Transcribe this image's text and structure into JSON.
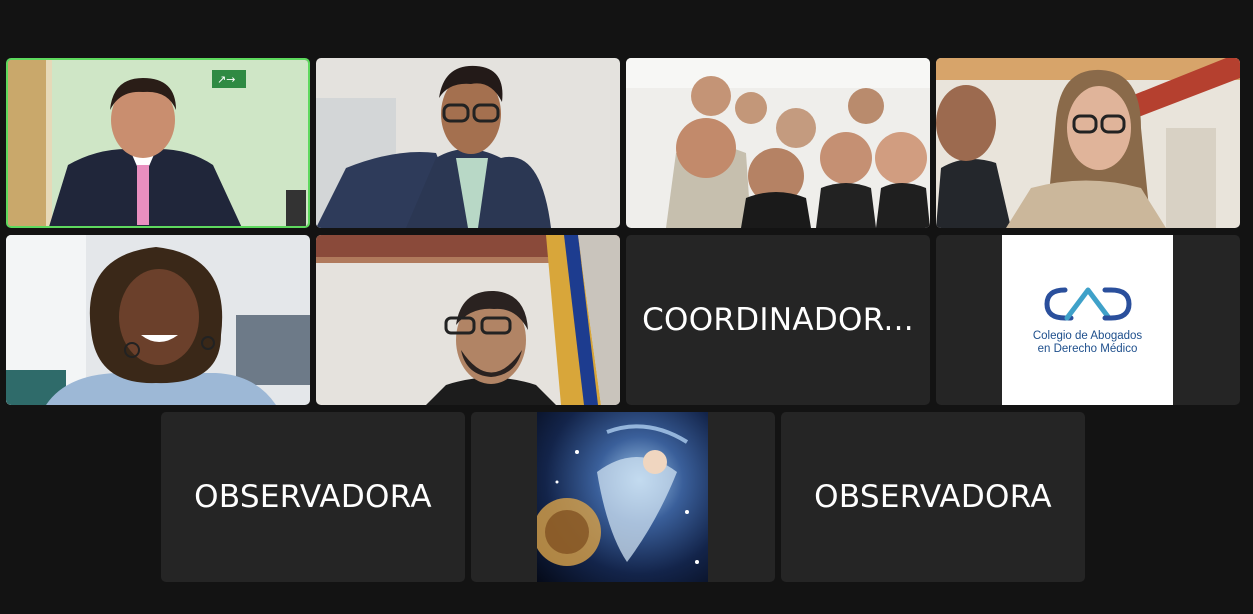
{
  "meeting": {
    "participants": [
      {
        "id": "p1",
        "kind": "video",
        "active": true
      },
      {
        "id": "p2",
        "kind": "video"
      },
      {
        "id": "p3",
        "kind": "video"
      },
      {
        "id": "p4",
        "kind": "video"
      },
      {
        "id": "p5",
        "kind": "video"
      },
      {
        "id": "p6",
        "kind": "video"
      },
      {
        "id": "p7",
        "kind": "name",
        "name": "COORDINADOR..."
      },
      {
        "id": "p8",
        "kind": "logo",
        "logo_line1": "Colegio de Abogados",
        "logo_line2": "en Derecho Médico"
      },
      {
        "id": "p9",
        "kind": "name",
        "name": "OBSERVADORA"
      },
      {
        "id": "p10",
        "kind": "avatar"
      },
      {
        "id": "p11",
        "kind": "name",
        "name": "OBSERVADORA"
      }
    ]
  },
  "colors": {
    "background": "#131313",
    "tile": "#252525",
    "active_speaker_border": "#5ed95e",
    "logo_blue": "#1e4f8c"
  },
  "icons": [
    "exit-sign-icon",
    "cad-logo-icon"
  ]
}
